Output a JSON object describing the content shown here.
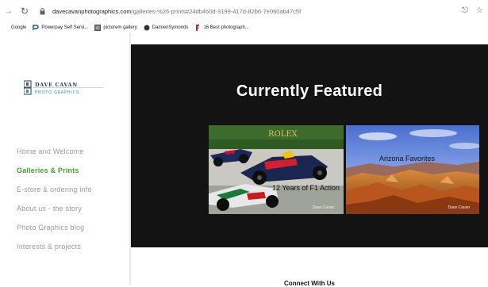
{
  "browser": {
    "url_host": "davecavanphotographics.com",
    "url_path": "/galleries-%26-prints#24db460d-3199-417d-82b6-7e060ab47c5f",
    "bookmarks": [
      {
        "label": "Google",
        "icon": "google-icon"
      },
      {
        "label": "Powerpay Self Servi...",
        "icon": "powerpay-icon",
        "color": "#1a5fb4"
      },
      {
        "label": "pictorem gallery",
        "icon": "gallery-icon"
      },
      {
        "label": "DamienSymonds",
        "icon": "damien-icon"
      },
      {
        "label": "16 Best photograph...",
        "icon": "photo-icon",
        "color": "#c62828"
      }
    ]
  },
  "site": {
    "logo_line1": "DAVE CAVAN",
    "logo_line2": "PHOTO GRAPHICS",
    "nav": [
      {
        "label": "Home and Welcome",
        "active": false
      },
      {
        "label": "Galleries & Prints",
        "active": true
      },
      {
        "label": "E-store & ordering info",
        "active": false
      },
      {
        "label": "About us - the story",
        "active": false
      },
      {
        "label": "Photo Graphics blog",
        "active": false
      },
      {
        "label": "Interests & projects",
        "active": false
      }
    ],
    "accent_color": "#4a9b33",
    "featured_title": "Currently Featured",
    "tiles": [
      {
        "label": "12 Years of F1 Action",
        "banner": "ROLEX",
        "signature": "Dave Cavan"
      },
      {
        "label": "Arizona Favorites",
        "signature": "Dave Cavan"
      }
    ],
    "connect": "Connect With Us"
  }
}
